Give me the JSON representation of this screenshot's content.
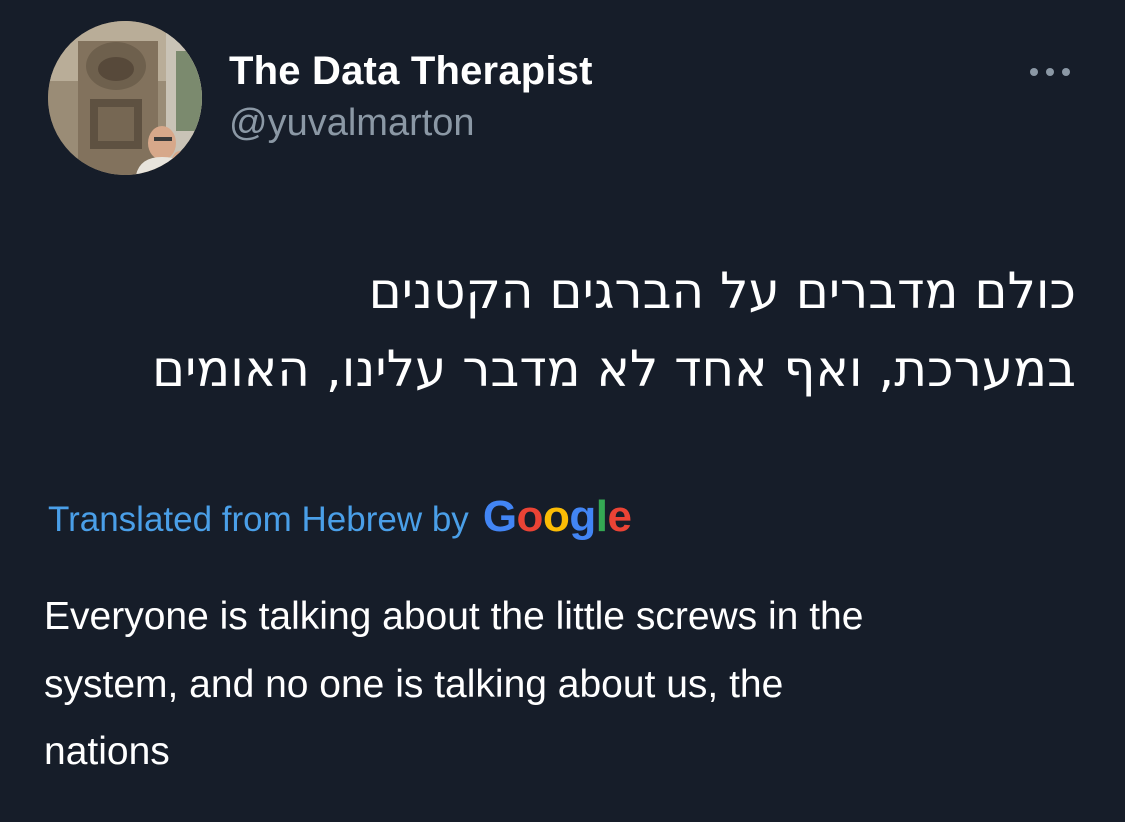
{
  "author": {
    "display_name": "The Data Therapist",
    "handle": "@yuvalmarton"
  },
  "icons": {
    "avatar": "profile-photo",
    "more": "more-horizontal-icon"
  },
  "tweet": {
    "original_line_1": "כולם מדברים על הברגים הקטנים",
    "original_line_2": "במערכת, ואף אחד לא מדבר עלינו, האומים",
    "translated_label": "Translated from Hebrew by",
    "translation_provider": "Google",
    "translation_line_1": "Everyone is talking about the little screws in the",
    "translation_line_2": "system, and no one is talking about us, the",
    "translation_line_3": "nations"
  },
  "colors": {
    "background": "#161d29",
    "text_primary": "#ffffff",
    "text_secondary": "#8b98a5",
    "link": "#4a9fe8"
  }
}
